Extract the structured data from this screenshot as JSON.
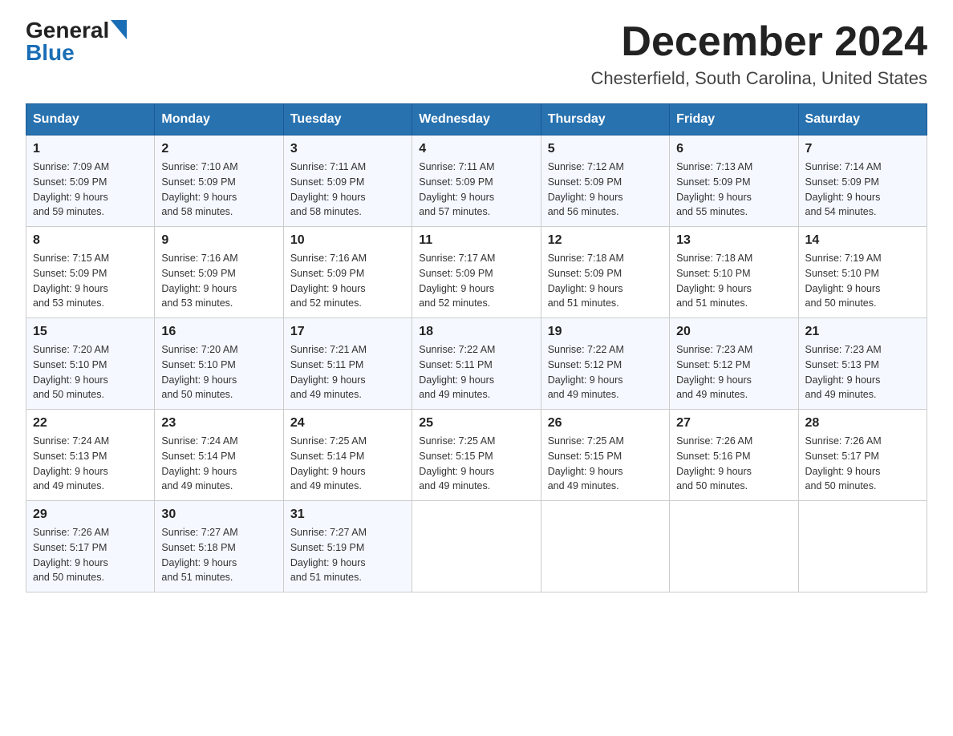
{
  "logo": {
    "general": "General",
    "blue": "Blue"
  },
  "header": {
    "month": "December 2024",
    "location": "Chesterfield, South Carolina, United States"
  },
  "days_of_week": [
    "Sunday",
    "Monday",
    "Tuesday",
    "Wednesday",
    "Thursday",
    "Friday",
    "Saturday"
  ],
  "weeks": [
    [
      {
        "day": "1",
        "sunrise": "7:09 AM",
        "sunset": "5:09 PM",
        "daylight": "9 hours and 59 minutes."
      },
      {
        "day": "2",
        "sunrise": "7:10 AM",
        "sunset": "5:09 PM",
        "daylight": "9 hours and 58 minutes."
      },
      {
        "day": "3",
        "sunrise": "7:11 AM",
        "sunset": "5:09 PM",
        "daylight": "9 hours and 58 minutes."
      },
      {
        "day": "4",
        "sunrise": "7:11 AM",
        "sunset": "5:09 PM",
        "daylight": "9 hours and 57 minutes."
      },
      {
        "day": "5",
        "sunrise": "7:12 AM",
        "sunset": "5:09 PM",
        "daylight": "9 hours and 56 minutes."
      },
      {
        "day": "6",
        "sunrise": "7:13 AM",
        "sunset": "5:09 PM",
        "daylight": "9 hours and 55 minutes."
      },
      {
        "day": "7",
        "sunrise": "7:14 AM",
        "sunset": "5:09 PM",
        "daylight": "9 hours and 54 minutes."
      }
    ],
    [
      {
        "day": "8",
        "sunrise": "7:15 AM",
        "sunset": "5:09 PM",
        "daylight": "9 hours and 53 minutes."
      },
      {
        "day": "9",
        "sunrise": "7:16 AM",
        "sunset": "5:09 PM",
        "daylight": "9 hours and 53 minutes."
      },
      {
        "day": "10",
        "sunrise": "7:16 AM",
        "sunset": "5:09 PM",
        "daylight": "9 hours and 52 minutes."
      },
      {
        "day": "11",
        "sunrise": "7:17 AM",
        "sunset": "5:09 PM",
        "daylight": "9 hours and 52 minutes."
      },
      {
        "day": "12",
        "sunrise": "7:18 AM",
        "sunset": "5:09 PM",
        "daylight": "9 hours and 51 minutes."
      },
      {
        "day": "13",
        "sunrise": "7:18 AM",
        "sunset": "5:10 PM",
        "daylight": "9 hours and 51 minutes."
      },
      {
        "day": "14",
        "sunrise": "7:19 AM",
        "sunset": "5:10 PM",
        "daylight": "9 hours and 50 minutes."
      }
    ],
    [
      {
        "day": "15",
        "sunrise": "7:20 AM",
        "sunset": "5:10 PM",
        "daylight": "9 hours and 50 minutes."
      },
      {
        "day": "16",
        "sunrise": "7:20 AM",
        "sunset": "5:10 PM",
        "daylight": "9 hours and 50 minutes."
      },
      {
        "day": "17",
        "sunrise": "7:21 AM",
        "sunset": "5:11 PM",
        "daylight": "9 hours and 49 minutes."
      },
      {
        "day": "18",
        "sunrise": "7:22 AM",
        "sunset": "5:11 PM",
        "daylight": "9 hours and 49 minutes."
      },
      {
        "day": "19",
        "sunrise": "7:22 AM",
        "sunset": "5:12 PM",
        "daylight": "9 hours and 49 minutes."
      },
      {
        "day": "20",
        "sunrise": "7:23 AM",
        "sunset": "5:12 PM",
        "daylight": "9 hours and 49 minutes."
      },
      {
        "day": "21",
        "sunrise": "7:23 AM",
        "sunset": "5:13 PM",
        "daylight": "9 hours and 49 minutes."
      }
    ],
    [
      {
        "day": "22",
        "sunrise": "7:24 AM",
        "sunset": "5:13 PM",
        "daylight": "9 hours and 49 minutes."
      },
      {
        "day": "23",
        "sunrise": "7:24 AM",
        "sunset": "5:14 PM",
        "daylight": "9 hours and 49 minutes."
      },
      {
        "day": "24",
        "sunrise": "7:25 AM",
        "sunset": "5:14 PM",
        "daylight": "9 hours and 49 minutes."
      },
      {
        "day": "25",
        "sunrise": "7:25 AM",
        "sunset": "5:15 PM",
        "daylight": "9 hours and 49 minutes."
      },
      {
        "day": "26",
        "sunrise": "7:25 AM",
        "sunset": "5:15 PM",
        "daylight": "9 hours and 49 minutes."
      },
      {
        "day": "27",
        "sunrise": "7:26 AM",
        "sunset": "5:16 PM",
        "daylight": "9 hours and 50 minutes."
      },
      {
        "day": "28",
        "sunrise": "7:26 AM",
        "sunset": "5:17 PM",
        "daylight": "9 hours and 50 minutes."
      }
    ],
    [
      {
        "day": "29",
        "sunrise": "7:26 AM",
        "sunset": "5:17 PM",
        "daylight": "9 hours and 50 minutes."
      },
      {
        "day": "30",
        "sunrise": "7:27 AM",
        "sunset": "5:18 PM",
        "daylight": "9 hours and 51 minutes."
      },
      {
        "day": "31",
        "sunrise": "7:27 AM",
        "sunset": "5:19 PM",
        "daylight": "9 hours and 51 minutes."
      },
      null,
      null,
      null,
      null
    ]
  ]
}
